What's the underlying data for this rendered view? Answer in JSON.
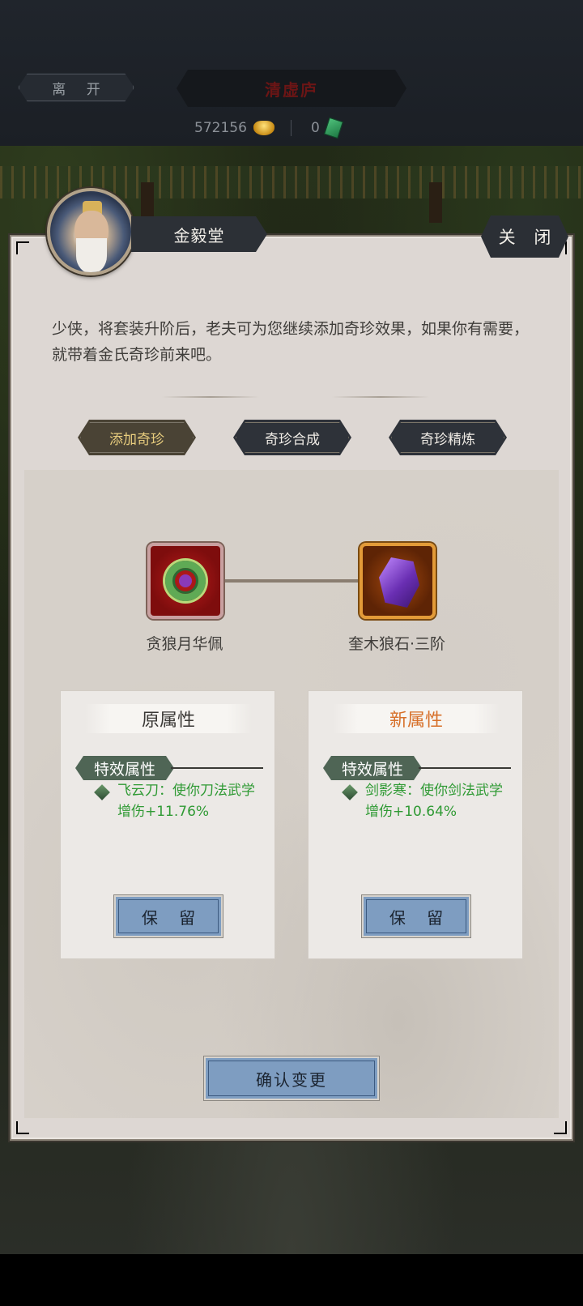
{
  "topbar": {
    "leave_label": "离 开",
    "title": "清虚庐",
    "gold_amount": "572156",
    "note_amount": "0"
  },
  "dialog": {
    "npc_name": "金毅堂",
    "close_label": "关 闭",
    "intro_text": "少侠，将套装升阶后，老夫可为您继续添加奇珍效果，如果你有需要，就带着金氏奇珍前来吧。",
    "tabs": [
      {
        "label": "添加奇珍",
        "active": true
      },
      {
        "label": "奇珍合成",
        "active": false
      },
      {
        "label": "奇珍精炼",
        "active": false
      }
    ],
    "items": {
      "left_name": "贪狼月华佩",
      "right_name": "奎木狼石·三阶"
    },
    "original": {
      "header": "原属性",
      "tag": "特效属性",
      "text": "飞云刀：使你刀法武学增伤+11.76%",
      "keep_label": "保 留"
    },
    "new": {
      "header": "新属性",
      "tag": "特效属性",
      "text": "剑影寒：使你剑法武学增伤+10.64%",
      "keep_label": "保 留"
    },
    "confirm_label": "确认变更"
  },
  "colors": {
    "new_header": "#d7702a",
    "attr_green": "#2f9a34",
    "button_blue": "#7e9dc1"
  }
}
